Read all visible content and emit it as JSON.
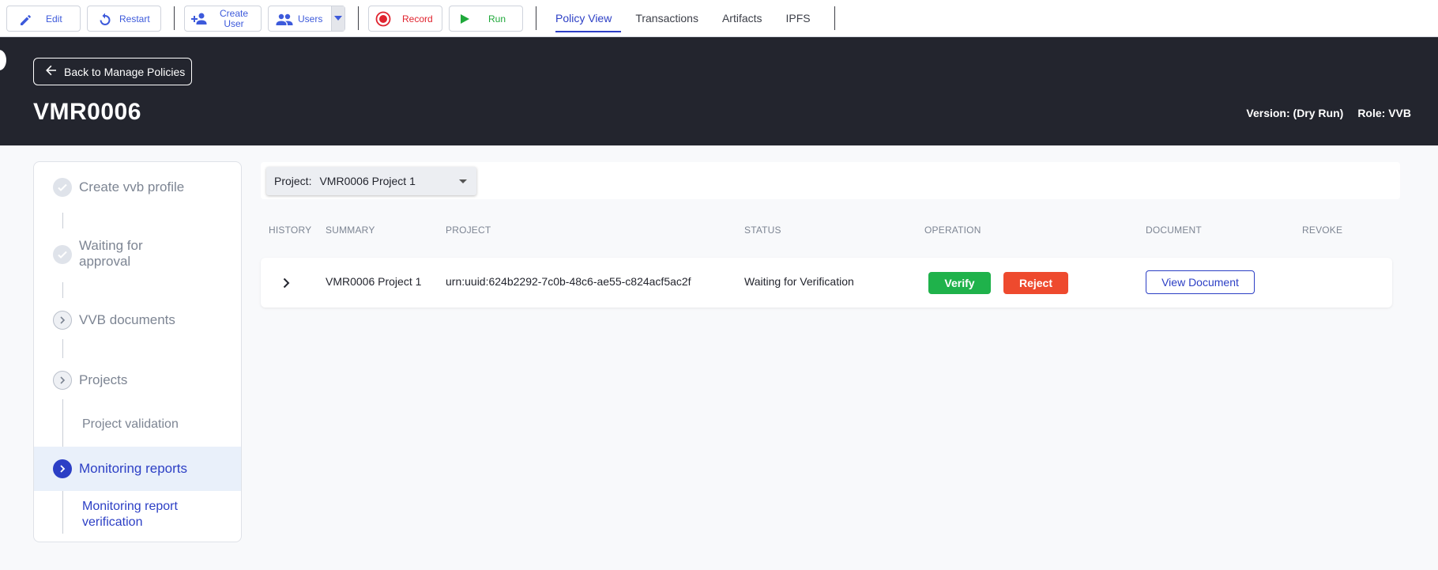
{
  "toolbar": {
    "edit_label": "Edit",
    "restart_label": "Restart",
    "create_user_label_1": "Create",
    "create_user_label_2": "User",
    "users_label": "Users",
    "record_label": "Record",
    "run_label": "Run",
    "tabs": [
      {
        "label": "Policy View",
        "active": true
      },
      {
        "label": "Transactions",
        "active": false
      },
      {
        "label": "Artifacts",
        "active": false
      },
      {
        "label": "IPFS",
        "active": false
      }
    ]
  },
  "header": {
    "back_label": "Back to Manage Policies",
    "title": "VMR0006",
    "version": "Version: (Dry Run)",
    "role": "Role: VVB"
  },
  "sidebar": {
    "steps": [
      {
        "label": "Create vvb profile",
        "state": "done"
      },
      {
        "label_1": "Waiting for",
        "label_2": "approval",
        "state": "done"
      },
      {
        "label": "VVB documents",
        "state": "pending"
      },
      {
        "label": "Projects",
        "state": "pending"
      },
      {
        "label": "Project validation",
        "state": "sub"
      },
      {
        "label": "Monitoring reports",
        "state": "current"
      },
      {
        "label_1": "Monitoring report",
        "label_2": "verification",
        "state": "sub-active"
      }
    ]
  },
  "project_filter": {
    "label": "Project:",
    "value": "VMR0006 Project 1"
  },
  "table": {
    "headers": [
      "HISTORY",
      "SUMMARY",
      "PROJECT",
      "STATUS",
      "OPERATION",
      "DOCUMENT",
      "REVOKE"
    ],
    "rows": [
      {
        "summary": "VMR0006 Project 1",
        "project": "urn:uuid:624b2292-7c0b-48c6-ae55-c824acf5ac2f",
        "status": "Waiting for Verification",
        "verify_label": "Verify",
        "reject_label": "Reject",
        "document_label": "View Document"
      }
    ]
  },
  "colors": {
    "accent": "#2c3fc5",
    "header_bg": "#23252e",
    "verify": "#1fb24b",
    "reject": "#ee4a2e",
    "record": "#e0232e",
    "run": "#1fa83a"
  }
}
